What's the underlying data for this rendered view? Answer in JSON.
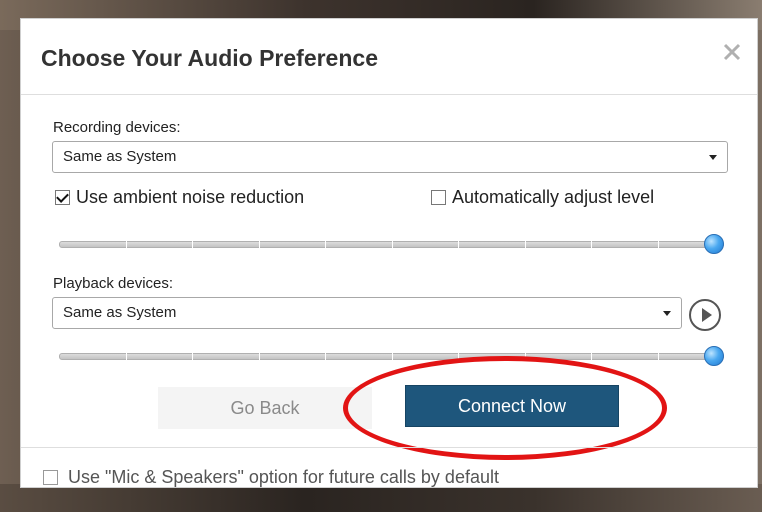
{
  "dialog": {
    "title": "Choose Your Audio Preference"
  },
  "recording": {
    "label": "Recording devices:",
    "selected": "Same as System",
    "ambient_noise_label": "Use ambient noise reduction",
    "ambient_noise_checked": true,
    "auto_adjust_label": "Automatically adjust level",
    "auto_adjust_checked": false,
    "level_fraction": 1.0
  },
  "playback": {
    "label": "Playback devices:",
    "selected": "Same as System",
    "level_fraction": 1.0
  },
  "buttons": {
    "back_label": "Go Back",
    "connect_label": "Connect Now"
  },
  "footer": {
    "default_option_label": "Use \"Mic & Speakers\" option for future calls by default",
    "default_option_checked": false
  },
  "colors": {
    "connect_button": "#1e567c",
    "highlight_ring": "#e21414",
    "slider_thumb": "#4aa8f0"
  },
  "icons": [
    "close-icon",
    "dropdown-caret-icon",
    "play-icon",
    "checkmark-icon"
  ]
}
